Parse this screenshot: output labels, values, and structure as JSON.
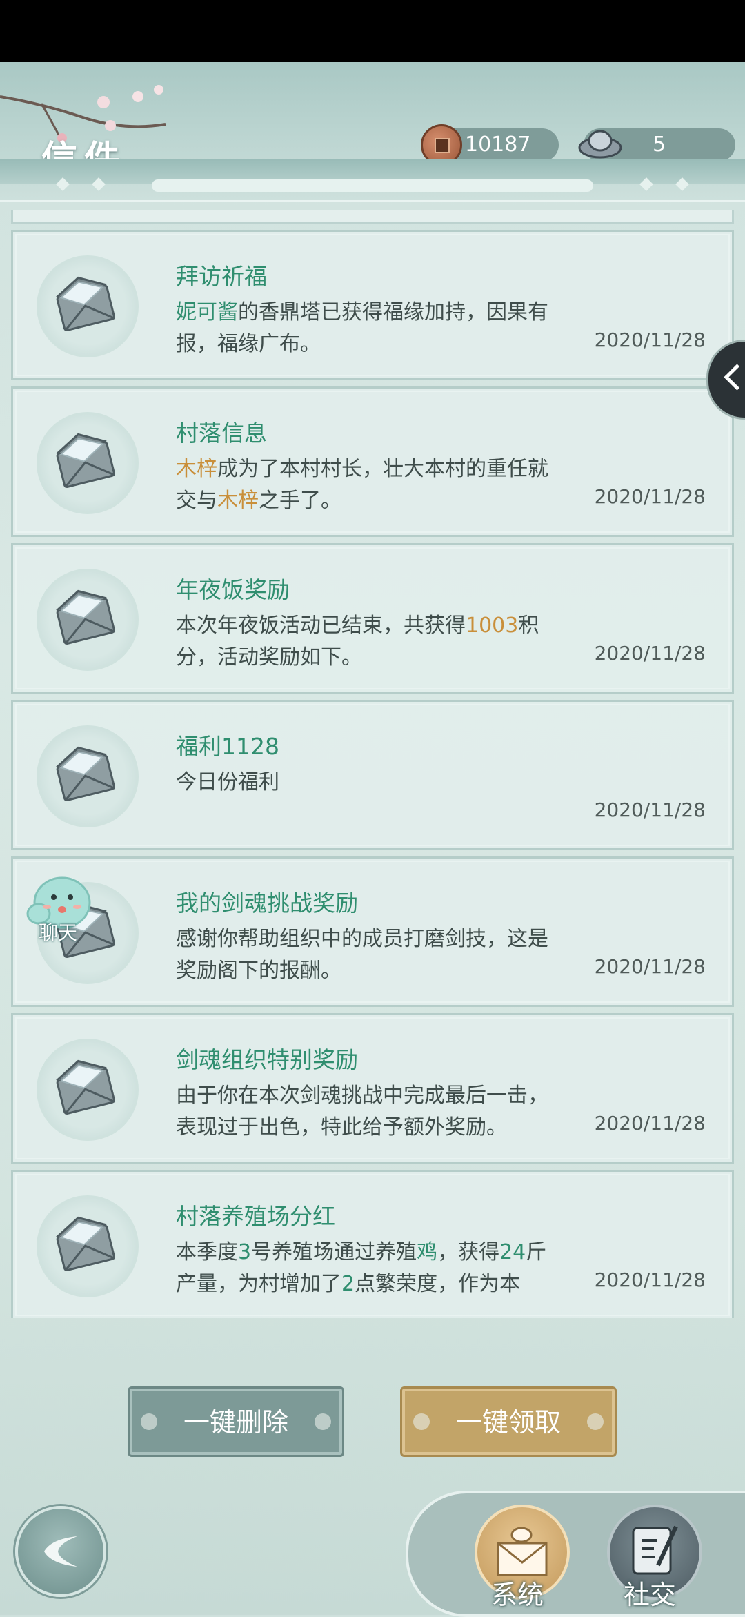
{
  "header": {
    "title": "信件",
    "coins": "10187",
    "ingots": "5"
  },
  "mails": [
    {
      "title": "拜访祈福",
      "date": "2020/11/28",
      "body": [
        {
          "t": "妮可酱",
          "c": "green"
        },
        {
          "t": "的香鼎塔已获得福缘加持，因果有报，福缘广布。"
        }
      ]
    },
    {
      "title": "村落信息",
      "date": "2020/11/28",
      "body": [
        {
          "t": "木梓",
          "c": "orange"
        },
        {
          "t": "成为了本村村长，壮大本村的重任就交与"
        },
        {
          "t": "木梓",
          "c": "orange"
        },
        {
          "t": "之手了。"
        }
      ]
    },
    {
      "title": "年夜饭奖励",
      "date": "2020/11/28",
      "body": [
        {
          "t": "本次年夜饭活动已结束，共获得"
        },
        {
          "t": "1003",
          "c": "orange"
        },
        {
          "t": "积分，活动奖励如下。"
        }
      ]
    },
    {
      "title": "福利1128",
      "date": "2020/11/28",
      "body": [
        {
          "t": "今日份福利"
        }
      ]
    },
    {
      "title": "我的剑魂挑战奖励",
      "date": "2020/11/28",
      "body": [
        {
          "t": "感谢你帮助组织中的成员打磨剑技，这是奖励阁下的报酬。"
        }
      ]
    },
    {
      "title": "剑魂组织特别奖励",
      "date": "2020/11/28",
      "body": [
        {
          "t": "由于你在本次剑魂挑战中完成最后一击，表现过于出色，特此给予额外奖励。"
        }
      ]
    },
    {
      "title": "村落养殖场分红",
      "date": "2020/11/28",
      "body": [
        {
          "t": "本季度"
        },
        {
          "t": "3",
          "c": "green"
        },
        {
          "t": "号养殖场通过养殖"
        },
        {
          "t": "鸡",
          "c": "green"
        },
        {
          "t": "，获得"
        },
        {
          "t": "24",
          "c": "green"
        },
        {
          "t": "斤产量，为村增加了"
        },
        {
          "t": "2",
          "c": "green"
        },
        {
          "t": "点繁荣度，作为本"
        }
      ]
    }
  ],
  "chat_label": "聊天",
  "buttons": {
    "delete_all": "一键删除",
    "claim_all": "一键领取"
  },
  "dock": {
    "system": "系统",
    "social": "社交"
  },
  "colors": {
    "title_green": "#2f8e6f",
    "highlight_orange": "#c98f3a",
    "claim_gold": "#c2a468",
    "delete_gray": "#7d9a97"
  },
  "icons": {
    "mail": "envelope-icon",
    "coin": "copper-coin-icon",
    "ingot": "silver-ingot-icon",
    "back": "back-arrow-icon",
    "side": "chevron-left-icon"
  }
}
